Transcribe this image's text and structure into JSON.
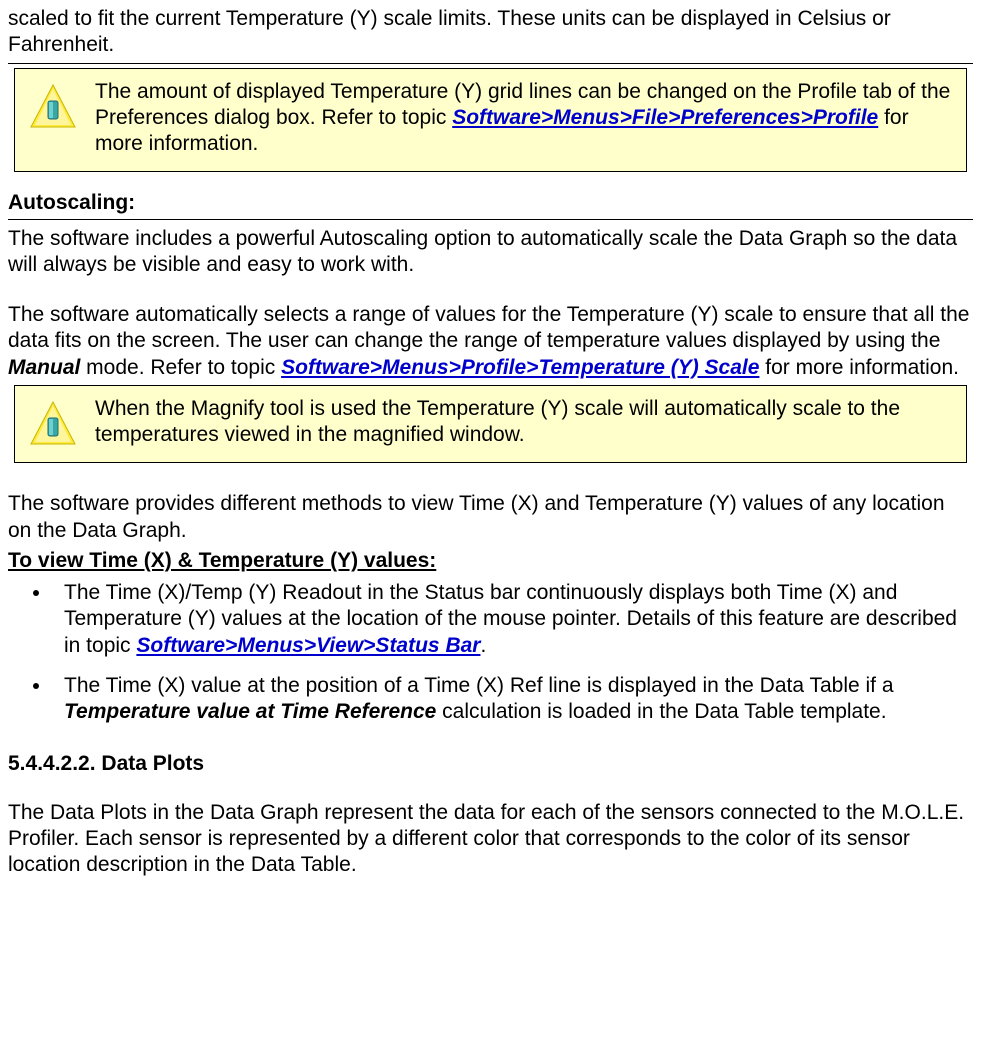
{
  "intro": {
    "text": "scaled to fit the current Temperature (Y) scale limits. These units can be displayed in Celsius or Fahrenheit."
  },
  "note1": {
    "pre": "The amount of displayed Temperature (Y) grid lines can be changed on the Profile tab of the Preferences dialog box. Refer to topic ",
    "link": "Software>Menus>File>Preferences>Profile",
    "post": " for more information."
  },
  "autoscaling": {
    "heading": "Autoscaling:",
    "p1": "The software includes a powerful Autoscaling option to automatically scale the Data Graph so the data will always be visible and easy to work with.",
    "p2_pre": "The software automatically selects a range of values for the Temperature (Y) scale to ensure that all the data fits on the screen. The user can change the range of temperature values displayed by using the ",
    "p2_bold": "Manual",
    "p2_mid": " mode. Refer to topic ",
    "p2_link": "Software>Menus>Profile>Temperature (Y) Scale",
    "p2_post": " for more information."
  },
  "note2": {
    "text": "When the Magnify tool is used the Temperature (Y) scale will automatically scale to the temperatures viewed in the magnified window."
  },
  "view": {
    "intro": "The software provides different methods to view Time (X) and Temperature (Y) values of any location on the Data Graph.",
    "heading": "To view Time (X) & Temperature (Y) values:",
    "bullet1_pre": "The Time (X)/Temp (Y) Readout in the Status bar continuously displays both Time (X) and Temperature (Y) values at the location of the mouse pointer. Details of this feature are described in topic ",
    "bullet1_link": "Software>Menus>View>Status Bar",
    "bullet1_post": ".",
    "bullet2_pre": "The Time (X) value at the position of a Time (X) Ref line is displayed in the Data Table if a ",
    "bullet2_bold": "Temperature value at Time Reference",
    "bullet2_post": " calculation is loaded in the Data Table template."
  },
  "dataplots": {
    "heading": "5.4.4.2.2. Data Plots",
    "p1": "The Data Plots in the Data Graph represent the data for each of the sensors connected to the M.O.L.E. Profiler. Each sensor is represented by a different color that corresponds to the color of its sensor location description in the Data Table."
  }
}
